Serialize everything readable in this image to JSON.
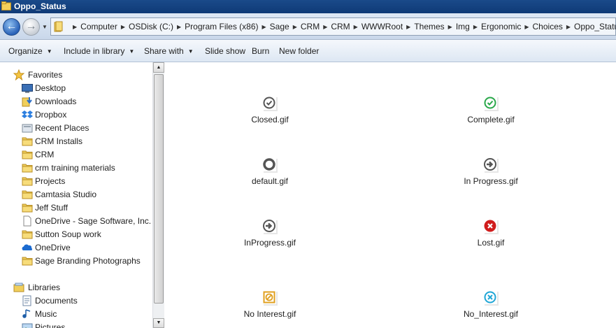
{
  "window": {
    "title": "Oppo_Status"
  },
  "address": {
    "breadcrumbs": [
      "Computer",
      "OSDisk (C:)",
      "Program Files (x86)",
      "Sage",
      "CRM",
      "CRM",
      "WWWRoot",
      "Themes",
      "Img",
      "Ergonomic",
      "Choices",
      "Oppo_Status"
    ]
  },
  "toolbar": {
    "organize": "Organize",
    "include": "Include in library",
    "share": "Share with",
    "slideshow": "Slide show",
    "burn": "Burn",
    "newfolder": "New folder"
  },
  "nav": {
    "favorites": "Favorites",
    "items": [
      {
        "label": "Desktop",
        "icon": "desktop-icon"
      },
      {
        "label": "Downloads",
        "icon": "downloads-icon"
      },
      {
        "label": "Dropbox",
        "icon": "dropbox-icon"
      },
      {
        "label": "Recent Places",
        "icon": "recent-places-icon"
      },
      {
        "label": "CRM Installs",
        "icon": "folder-icon"
      },
      {
        "label": "CRM",
        "icon": "folder-icon"
      },
      {
        "label": "crm training materials",
        "icon": "folder-icon"
      },
      {
        "label": "Projects",
        "icon": "folder-icon"
      },
      {
        "label": "Camtasia Studio",
        "icon": "folder-icon"
      },
      {
        "label": "Jeff Stuff",
        "icon": "folder-icon"
      },
      {
        "label": "OneDrive - Sage Software, Inc.",
        "icon": "document-icon"
      },
      {
        "label": "Sutton Soup work",
        "icon": "folder-icon"
      },
      {
        "label": "OneDrive",
        "icon": "onedrive-icon"
      },
      {
        "label": "Sage Branding Photographs",
        "icon": "folder-icon"
      }
    ],
    "libraries": "Libraries",
    "lib_items": [
      {
        "label": "Documents",
        "icon": "documents-icon"
      },
      {
        "label": "Music",
        "icon": "music-icon"
      },
      {
        "label": "Pictures",
        "icon": "pictures-icon"
      }
    ]
  },
  "files": [
    {
      "name": "Closed.gif",
      "icon": "closed-check-icon",
      "color": "#555555"
    },
    {
      "name": "Complete.gif",
      "icon": "complete-check-icon",
      "color": "#2aa84a"
    },
    {
      "name": "default.gif",
      "icon": "default-ring-icon",
      "color": "#555555"
    },
    {
      "name": "In Progress.gif",
      "icon": "in-progress-arrow-icon",
      "color": "#555555"
    },
    {
      "name": "InProgress.gif",
      "icon": "inprogress-arrow-icon",
      "color": "#555555"
    },
    {
      "name": "Lost.gif",
      "icon": "lost-x-icon",
      "color": "#d01c1c"
    },
    {
      "name": "No Interest.gif",
      "icon": "no-interest-slash-icon",
      "color": "#e0a020"
    },
    {
      "name": "No_Interest.gif",
      "icon": "no-interest-x-icon",
      "color": "#1fa6d6"
    }
  ]
}
